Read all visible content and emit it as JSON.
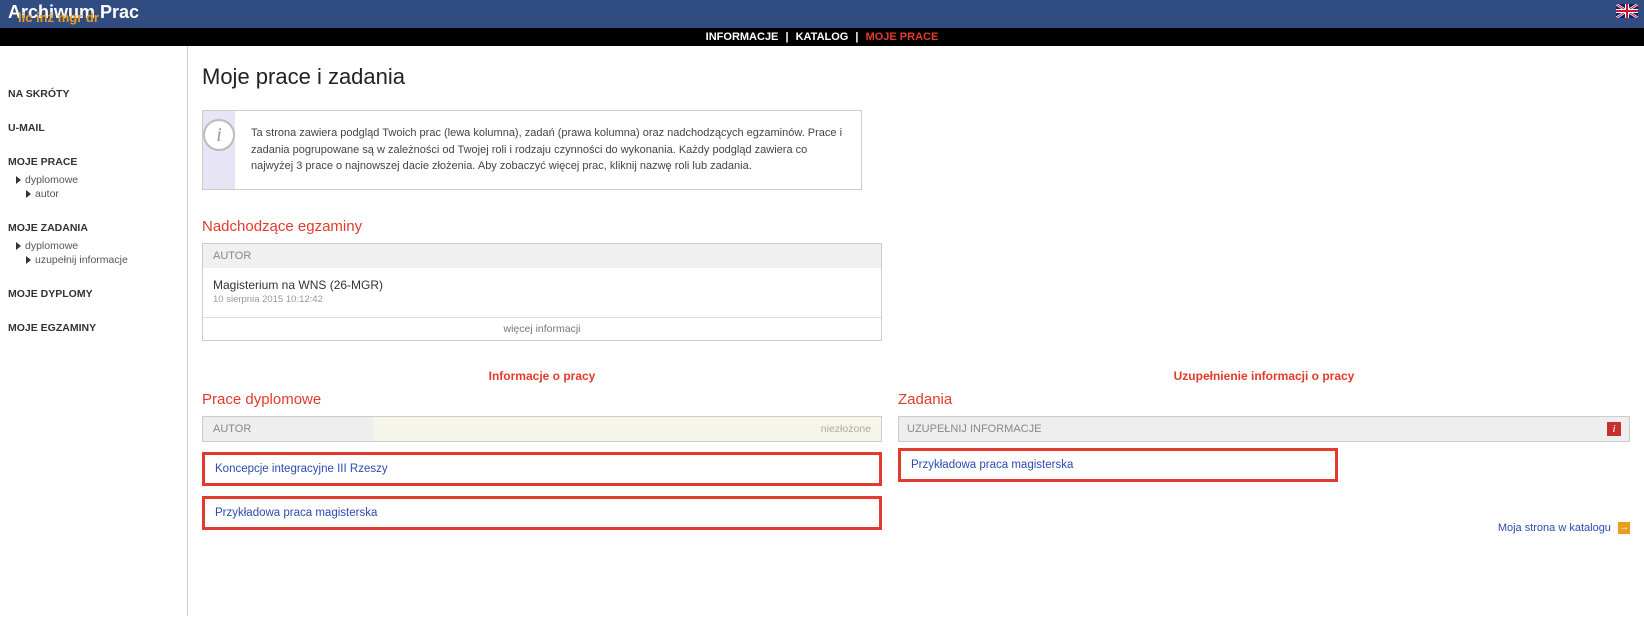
{
  "header": {
    "logo_title": "Archiwum Prac",
    "logo_subtitle": "lic inż mgr dr",
    "flag": "uk-flag"
  },
  "nav": {
    "item1": "INFORMACJE",
    "item2": "KATALOG",
    "item3": "MOJE PRACE"
  },
  "sidebar": {
    "shortcuts_title": "NA SKRÓTY",
    "umail": "U-MAIL",
    "my_works": "MOJE PRACE",
    "dyplomowe": "dyplomowe",
    "autor": "autor",
    "my_tasks": "MOJE ZADANIA",
    "uzupelnij": "uzupełnij informacje",
    "my_diplomas": "MOJE DYPLOMY",
    "my_exams": "MOJE EGZAMINY"
  },
  "main": {
    "title": "Moje prace i zadania",
    "info_text": "Ta strona zawiera podgląd Twoich prac (lewa kolumna), zadań (prawa kolumna) oraz nadchodzących egzaminów. Prace i zadania pogrupowane są w zależności od Twojej roli i rodzaju czynności do wykonania. Każdy podgląd zawiera co najwyżej 3 prace o najnowszej dacie złożenia. Aby zobaczyć więcej prac, kliknij nazwę roli lub zadania.",
    "exams_heading": "Nadchodzące egzaminy",
    "exams_panel_head": "AUTOR",
    "exam_title": "Magisterium na WNS (26-MGR)",
    "exam_date": "10 sierpnia 2015 10:12:42",
    "more_info": "więcej informacji",
    "annot_left": "Informacje o pracy",
    "annot_right": "Uzupełnienie informacji o pracy",
    "theses_heading": "Prace dyplomowe",
    "tasks_heading": "Zadania",
    "author_label": "AUTOR",
    "status_label": "niezłożone",
    "thesis1": "Koncepcje integracyjne III Rzeszy",
    "thesis2": "Przykładowa praca magisterska",
    "tasks_panel_head": "UZUPEŁNIJ INFORMACJE",
    "task1": "Przykładowa praca magisterska",
    "footer_link": "Moja strona w katalogu"
  }
}
